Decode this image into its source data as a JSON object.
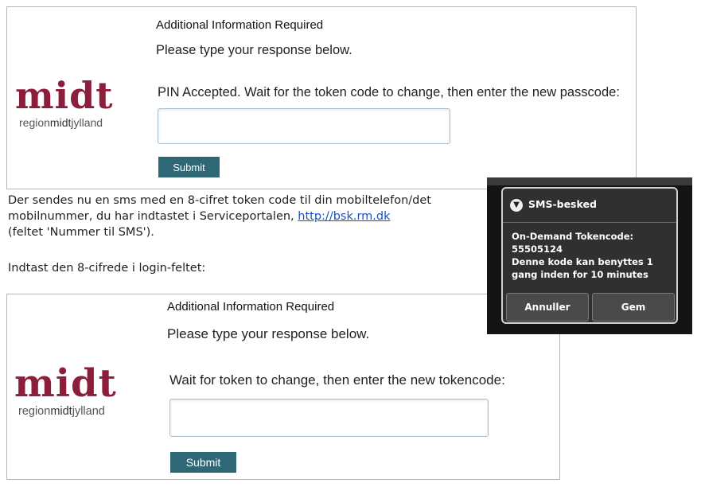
{
  "panel1": {
    "logo_word": "midt",
    "logo_sub_region": "region",
    "logo_sub_midt": "midt",
    "logo_sub_jylland": "jylland",
    "title": "Additional Information Required",
    "subtitle": "Please type your response below.",
    "prompt": "PIN Accepted. Wait for the token code to change, then enter the new passcode:",
    "input_value": "",
    "submit_label": "Submit"
  },
  "instructions": {
    "line1": "Der sendes nu en sms med en 8-cifret token code til din mobiltelefon/det",
    "line2_prefix": "mobilnummer, du har indtastet i Serviceportalen, ",
    "link_text": "http://bsk.rm.dk",
    "line3": "(feltet 'Nummer til SMS').",
    "line4": "Indtast den 8-cifrede i login-feltet:"
  },
  "panel2": {
    "logo_word": "midt",
    "logo_sub_region": "region",
    "logo_sub_midt": "midt",
    "logo_sub_jylland": "jylland",
    "title": "Additional Information Required",
    "subtitle": "Please type your response below.",
    "prompt": "Wait for token to change, then enter the new tokencode:",
    "input_value": "",
    "submit_label": "Submit"
  },
  "sms": {
    "icon": "chevron-down-circle-icon",
    "title": "SMS-besked",
    "lines": [
      "On-Demand Tokencode:",
      "55505124",
      "Denne kode kan benyttes 1",
      "gang inden for  10 minutes"
    ],
    "cancel_label": "Annuller",
    "save_label": "Gem"
  },
  "colors": {
    "brand": "#8c1d3b",
    "button": "#2e6877",
    "link": "#1a4fc4"
  }
}
